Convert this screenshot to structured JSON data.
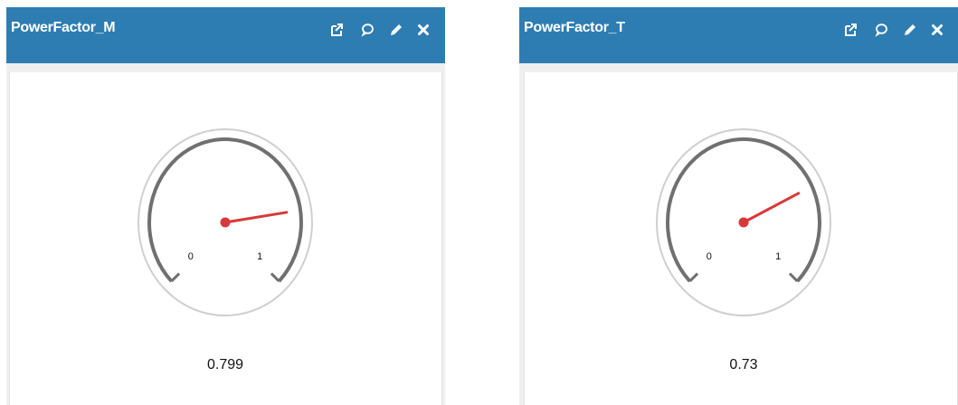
{
  "colors": {
    "header": "#2e7db2",
    "needle": "#d9383a",
    "arc": "#707070",
    "ring": "#cfcfcf"
  },
  "icons": [
    "external-link-icon",
    "comment-icon",
    "edit-pencil-icon",
    "close-icon"
  ],
  "panels": [
    {
      "title": "PowerFactor_M",
      "gauge": {
        "min_label": "0",
        "max_label": "1",
        "min": 0,
        "max": 1,
        "value": 0.799,
        "value_label": "0.799"
      }
    },
    {
      "title": "PowerFactor_T",
      "gauge": {
        "min_label": "0",
        "max_label": "1",
        "min": 0,
        "max": 1,
        "value": 0.73,
        "value_label": "0.73"
      }
    }
  ]
}
